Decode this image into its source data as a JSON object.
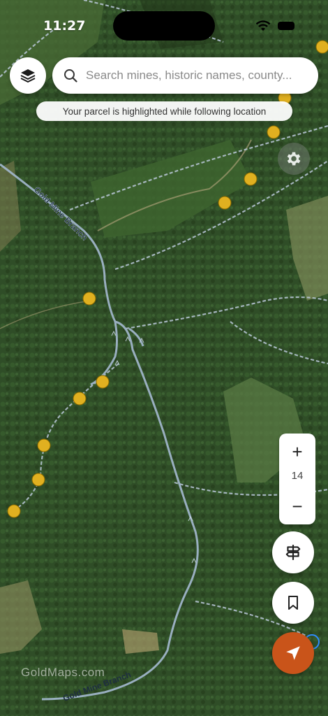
{
  "status_bar": {
    "time": "11:27"
  },
  "search": {
    "placeholder": "Search mines, historic names, county..."
  },
  "toast": {
    "message": "Your parcel is highlighted while following location"
  },
  "zoom": {
    "plus_label": "+",
    "level": "14",
    "minus_label": "−"
  },
  "map": {
    "base_layer": "satellite",
    "stream_name": "Gold Mine Branch",
    "watermark": "GoldMaps.com",
    "poi_color": "#e0b020",
    "accent_color": "#c9541a"
  },
  "icons": {
    "layers": "layers-icon",
    "search": "search-icon",
    "settings": "gear-icon",
    "route": "signpost-icon",
    "bookmark": "bookmark-icon",
    "locate": "navigation-arrow-icon"
  }
}
